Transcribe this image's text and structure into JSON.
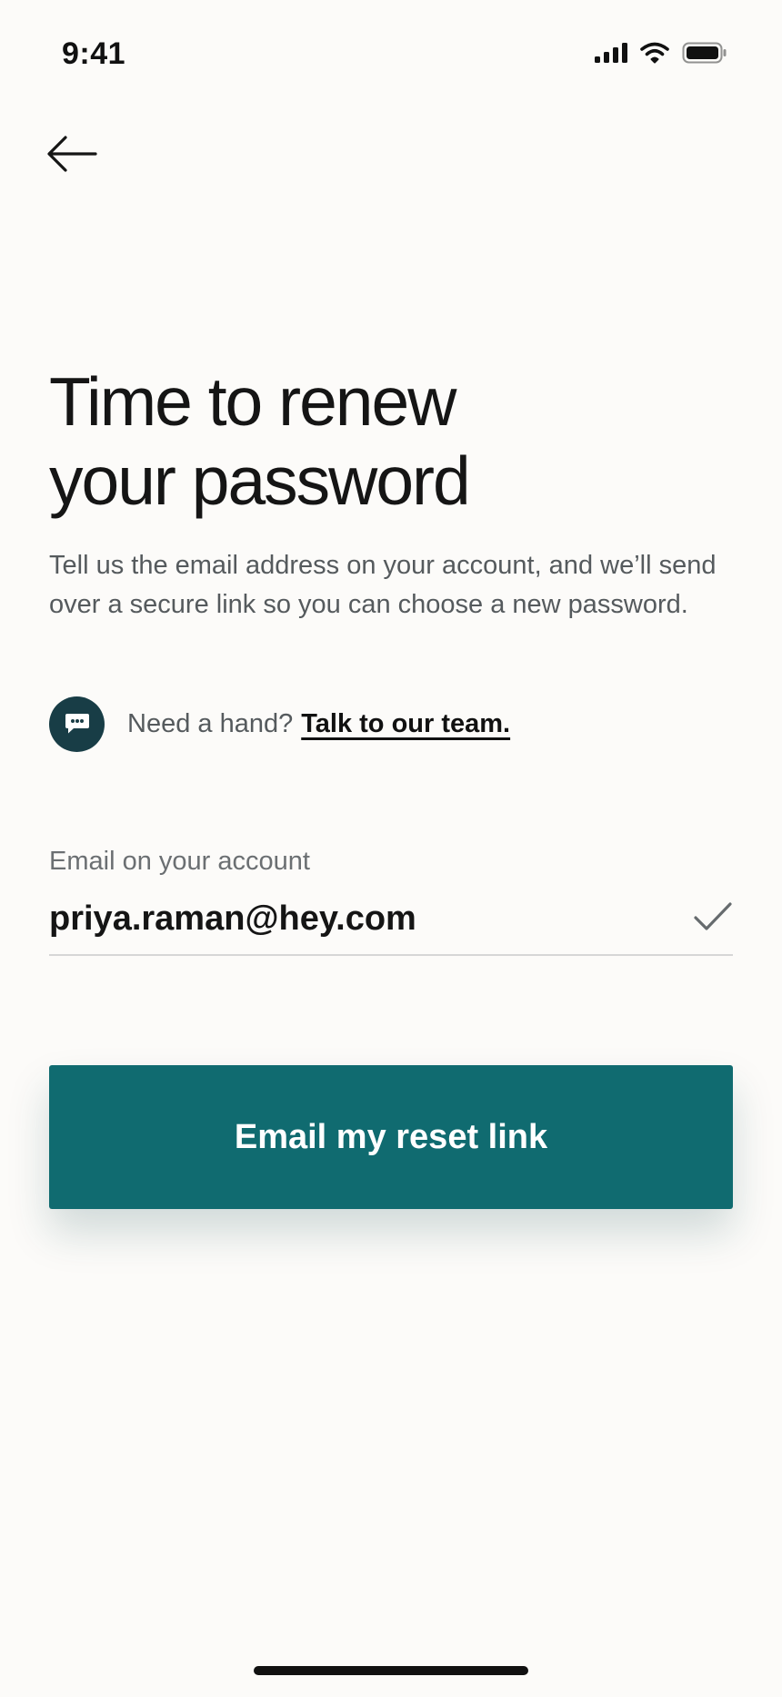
{
  "status_bar": {
    "time": "9:41"
  },
  "nav": {
    "back_icon": "arrow-left-icon"
  },
  "headline": {
    "line1": "Time to renew",
    "line2": "your password"
  },
  "description": "Tell us the email address on your account, and we’ll send over a secure link so you can choose a new password.",
  "help": {
    "icon": "chat-bubble-icon",
    "prompt": "Need a hand?",
    "link_label": "Talk to our team."
  },
  "email_field": {
    "label": "Email on your account",
    "value": "priya.raman@hey.com",
    "valid_icon": "checkmark-icon"
  },
  "primary_action": {
    "label": "Email my reset link"
  },
  "colors": {
    "background": "#fcfbf9",
    "primary_button": "#106b70",
    "chat_icon_bg": "#183d46",
    "text_primary": "#151515",
    "text_secondary": "#555a5d"
  }
}
